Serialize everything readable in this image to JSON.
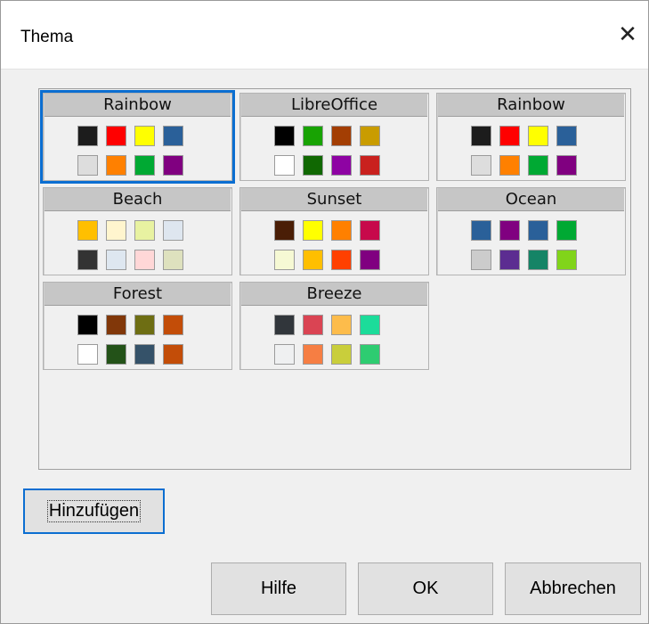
{
  "window": {
    "title": "Thema",
    "close_glyph": "✕"
  },
  "themes": [
    {
      "name": "Rainbow",
      "selected": true,
      "colors": [
        "#1c1c1c",
        "#ff0000",
        "#ffff00",
        "#2a6099",
        "#dddddd",
        "#ff8000",
        "#00a933",
        "#800080"
      ]
    },
    {
      "name": "LibreOffice",
      "selected": false,
      "colors": [
        "#000000",
        "#18a303",
        "#a33e03",
        "#c99c00",
        "#ffffff",
        "#106802",
        "#8e03a3",
        "#c9211e"
      ]
    },
    {
      "name": "Rainbow",
      "selected": false,
      "colors": [
        "#1c1c1c",
        "#ff0000",
        "#ffff00",
        "#2a6099",
        "#dddddd",
        "#ff8000",
        "#00a933",
        "#800080"
      ]
    },
    {
      "name": "Beach",
      "selected": false,
      "colors": [
        "#ffbf00",
        "#fff5ce",
        "#e8f2a1",
        "#dee6ef",
        "#333333",
        "#dee7f0",
        "#ffd7d7",
        "#dee1be"
      ]
    },
    {
      "name": "Sunset",
      "selected": false,
      "colors": [
        "#4a1e06",
        "#ffff00",
        "#ff8000",
        "#c7094b",
        "#f6f9d4",
        "#ffbf00",
        "#ff4000",
        "#800080"
      ]
    },
    {
      "name": "Ocean",
      "selected": false,
      "colors": [
        "#2a6099",
        "#800080",
        "#2a6099",
        "#00a933",
        "#cccccc",
        "#5c2d91",
        "#158466",
        "#81d41a"
      ]
    },
    {
      "name": "Forest",
      "selected": false,
      "colors": [
        "#000000",
        "#813709",
        "#6e6e13",
        "#c34d08",
        "#ffffff",
        "#235218",
        "#355269",
        "#c34d08"
      ]
    },
    {
      "name": "Breeze",
      "selected": false,
      "colors": [
        "#31363b",
        "#da4453",
        "#fdbc4b",
        "#1cdc9a",
        "#eff0f1",
        "#f67e43",
        "#c9ce3b",
        "#2ecc71"
      ]
    }
  ],
  "buttons": {
    "add": "Hinzufügen",
    "help": "Hilfe",
    "ok": "OK",
    "cancel": "Abbrechen"
  }
}
